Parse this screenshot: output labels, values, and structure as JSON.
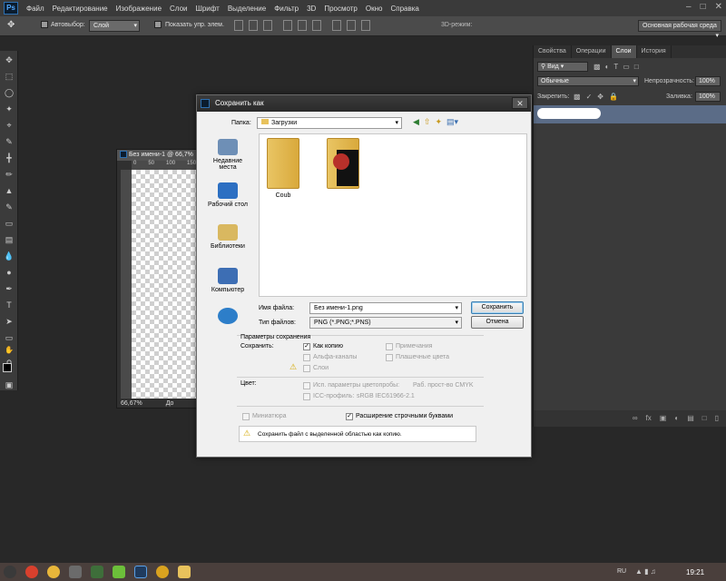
{
  "app": {
    "logo": "Ps",
    "menu": [
      "Файл",
      "Редактирование",
      "Изображение",
      "Слои",
      "Шрифт",
      "Выделение",
      "Фильтр",
      "3D",
      "Просмотр",
      "Окно",
      "Справка"
    ]
  },
  "options_bar": {
    "autoselect_label": "Автовыбор:",
    "autoselect_value": "Слой",
    "show_controls_label": "Показать упр. элем.",
    "mode_3d_label": "3D-режим:",
    "workspace": "Основная рабочая среда"
  },
  "panel": {
    "tabs": [
      "Свойства",
      "Операции",
      "Слои",
      "История"
    ],
    "active_tab": "Слои",
    "kind_filter": "Вид",
    "blend_mode": "Обычные",
    "opacity_label": "Непрозрачность:",
    "opacity_value": "100%",
    "lock_label": "Закрепить:",
    "fill_label": "Заливка:",
    "fill_value": "100%"
  },
  "document": {
    "title": "Без имени-1 @ 66,7%",
    "ruler_ticks": [
      "0",
      "50",
      "100",
      "150"
    ],
    "zoom": "66,67%",
    "status_partial": "До"
  },
  "dialog": {
    "title": "Сохранить как",
    "folder_label": "Папка:",
    "folder_value": "Загрузки",
    "places": [
      {
        "label": "Недавние места",
        "icon": "recent-places-icon"
      },
      {
        "label": "Рабочий стол",
        "icon": "desktop-icon"
      },
      {
        "label": "Библиотеки",
        "icon": "libraries-icon"
      },
      {
        "label": "Компьютер",
        "icon": "computer-icon"
      },
      {
        "label": "",
        "icon": "network-icon"
      }
    ],
    "files": [
      {
        "name": "Coub",
        "icon": "folder-icon"
      },
      {
        "name": "",
        "icon": "folder-icon"
      }
    ],
    "filename_label": "Имя файла:",
    "filename_value": "Без имени-1.png",
    "filetype_label": "Тип файлов:",
    "filetype_value": "PNG (*.PNG;*.PNS)",
    "save_button": "Сохранить",
    "cancel_button": "Отмена",
    "save_options_heading": "Параметры сохранения",
    "save_label": "Сохранить:",
    "as_copy": "Как копию",
    "notes": "Примечания",
    "alpha": "Альфа-каналы",
    "spot_colors": "Плашечные цвета",
    "layers": "Слои",
    "color_label": "Цвет:",
    "proof_setup": "Исп. параметры цветопробы:",
    "proof_value": "Раб. прост-во CMYK",
    "icc_profile": "ICC-профиль:",
    "icc_value": "sRGB IEC61966-2.1",
    "thumbnail": "Миниатюра",
    "lowercase_ext": "Расширение строчными буквами",
    "warning": "Сохранить файл с выделенной областью как копию."
  },
  "taskbar": {
    "language": "RU",
    "time": "19:21"
  }
}
